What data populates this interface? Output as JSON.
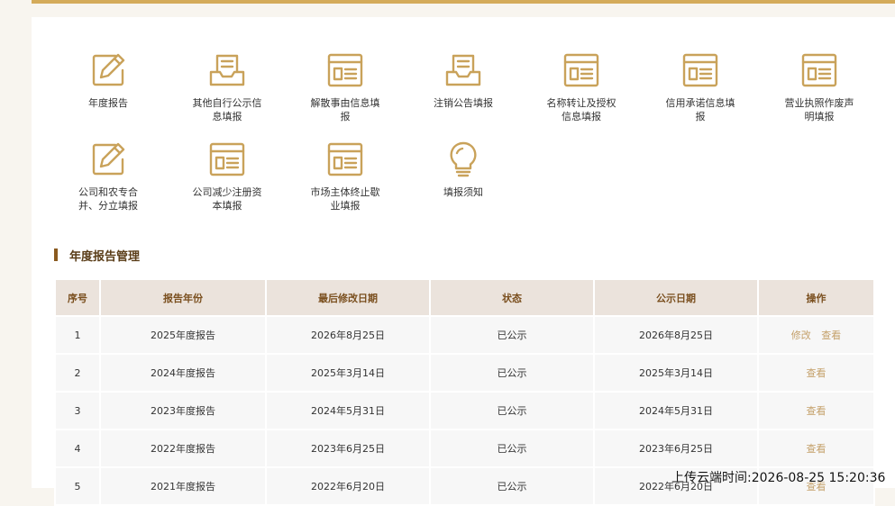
{
  "icons": [
    {
      "label": "年度报告",
      "icon": "edit-icon"
    },
    {
      "label": "其他自行公示信息填报",
      "icon": "inbox-icon"
    },
    {
      "label": "解散事由信息填报",
      "icon": "form-window-icon"
    },
    {
      "label": "注销公告填报",
      "icon": "inbox-icon"
    },
    {
      "label": "名称转让及授权信息填报",
      "icon": "form-window-icon"
    },
    {
      "label": "信用承诺信息填报",
      "icon": "form-window-icon"
    },
    {
      "label": "营业执照作废声明填报",
      "icon": "form-window-icon"
    },
    {
      "label": "公司和农专合并、分立填报",
      "icon": "edit-icon"
    },
    {
      "label": "公司减少注册资本填报",
      "icon": "form-window-icon"
    },
    {
      "label": "市场主体终止歇业填报",
      "icon": "form-window-icon"
    },
    {
      "label": "填报须知",
      "icon": "lightbulb-icon"
    }
  ],
  "icon_color": "#c9a25a",
  "section": {
    "title": "年度报告管理"
  },
  "table": {
    "headers": [
      "序号",
      "报告年份",
      "最后修改日期",
      "状态",
      "公示日期",
      "操作"
    ],
    "rows": [
      {
        "no": "1",
        "year": "2025年度报告",
        "modified": "2026年8月25日",
        "status": "已公示",
        "published": "2026年8月25日",
        "actions": [
          "修改",
          "查看"
        ]
      },
      {
        "no": "2",
        "year": "2024年度报告",
        "modified": "2025年3月14日",
        "status": "已公示",
        "published": "2025年3月14日",
        "actions": [
          "查看"
        ]
      },
      {
        "no": "3",
        "year": "2023年度报告",
        "modified": "2024年5月31日",
        "status": "已公示",
        "published": "2024年5月31日",
        "actions": [
          "查看"
        ]
      },
      {
        "no": "4",
        "year": "2022年度报告",
        "modified": "2023年6月25日",
        "status": "已公示",
        "published": "2023年6月25日",
        "actions": [
          "查看"
        ]
      },
      {
        "no": "5",
        "year": "2021年度报告",
        "modified": "2022年6月20日",
        "status": "已公示",
        "published": "2022年6月20日",
        "actions": [
          "查看"
        ]
      }
    ]
  },
  "watermark": "上传云端时间:2026-08-25 15:20:36"
}
